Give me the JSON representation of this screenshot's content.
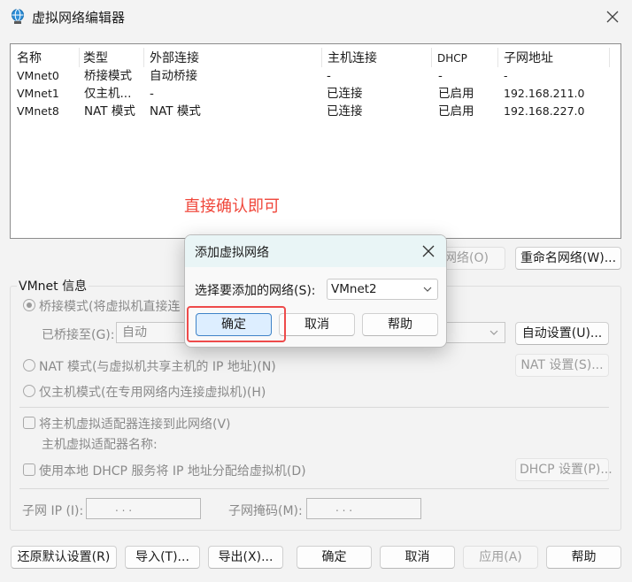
{
  "window": {
    "title": "虚拟网络编辑器",
    "icon": "network-globe-icon",
    "close_icon": "close-icon"
  },
  "table": {
    "headers": [
      "名称",
      "类型",
      "外部连接",
      "主机连接",
      "DHCP",
      "子网地址"
    ],
    "rows": [
      [
        "VMnet0",
        "桥接模式",
        "自动桥接",
        "-",
        "-",
        "-"
      ],
      [
        "VMnet1",
        "仅主机...",
        "-",
        "已连接",
        "已启用",
        "192.168.211.0"
      ],
      [
        "VMnet8",
        "NAT 模式",
        "NAT 模式",
        "已连接",
        "已启用",
        "192.168.227.0"
      ]
    ]
  },
  "annotation": "直接确认即可",
  "net_buttons": {
    "remove": "网络(O)",
    "rename": "重命名网络(W)..."
  },
  "vmnet_info": {
    "label": "VMnet 信息",
    "bridge_radio": "桥接模式(将虚拟机直接连",
    "bridged_to_label": "已桥接至(G):",
    "bridged_to_value": "自动",
    "auto_settings": "自动设置(U)...",
    "nat_radio": "NAT 模式(与虚拟机共享主机的 IP 地址)(N)",
    "nat_settings": "NAT 设置(S)...",
    "host_only_radio": "仅主机模式(在专用网络内连接虚拟机)(H)",
    "connect_adapter": "将主机虚拟适配器连接到此网络(V)",
    "adapter_name": "主机虚拟适配器名称:",
    "dhcp_check": "使用本地 DHCP 服务将 IP 地址分配给虚拟机(D)",
    "dhcp_settings": "DHCP 设置(P)...",
    "subnet_ip": "子网 IP (I):",
    "subnet_mask": "子网掩码(M):",
    "ip_dots": ".    .    ."
  },
  "footer": {
    "restore": "还原默认设置(R)",
    "import": "导入(T)...",
    "export": "导出(X)...",
    "ok": "确定",
    "cancel": "取消",
    "apply": "应用(A)",
    "help": "帮助"
  },
  "dialog": {
    "title": "添加虚拟网络",
    "select_label": "选择要添加的网络(S):",
    "selected_value": "VMnet2",
    "ok": "确定",
    "cancel": "取消",
    "help": "帮助"
  },
  "colors": {
    "annotation": "#f0473b",
    "highlight_box": "#ee4b4b",
    "dialog_header": "#e9f5f6",
    "primary_border": "#3f83c8"
  }
}
